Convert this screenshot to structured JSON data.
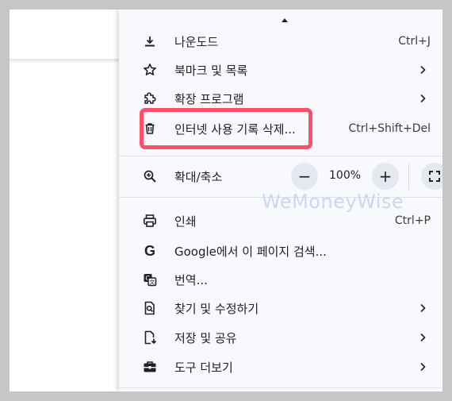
{
  "menu": {
    "items": [
      {
        "name": "download",
        "label": "나운도드",
        "shortcut": "Ctrl+J",
        "icon": "download-icon"
      },
      {
        "name": "bookmarks",
        "label": "북마크 및 목록",
        "submenu": true,
        "icon": "star-icon"
      },
      {
        "name": "extensions",
        "label": "확장 프로그램",
        "submenu": true,
        "icon": "puzzle-icon"
      },
      {
        "name": "clear-history",
        "label": "인터넷 사용 기록 삭제...",
        "shortcut": "Ctrl+Shift+Del",
        "icon": "trash-icon"
      }
    ],
    "zoom": {
      "label": "확대/축소",
      "value": "100%",
      "minus": "−",
      "plus": "+"
    },
    "items2": [
      {
        "name": "print",
        "label": "인쇄",
        "shortcut": "Ctrl+P",
        "icon": "printer-icon"
      },
      {
        "name": "google-search",
        "label": "Google에서 이 페이지 검색...",
        "icon": "google-icon"
      },
      {
        "name": "translate",
        "label": "번역...",
        "icon": "translate-icon"
      },
      {
        "name": "find-edit",
        "label": "찾기 및 수정하기",
        "submenu": true,
        "icon": "find-icon"
      },
      {
        "name": "save-share",
        "label": "저장 및 공유",
        "submenu": true,
        "icon": "save-icon"
      },
      {
        "name": "more-tools",
        "label": "도구 더보기",
        "submenu": true,
        "icon": "toolbox-icon"
      }
    ]
  },
  "watermark": "WeMoneyWise",
  "colors": {
    "highlight": "#ff4f6a",
    "menu_bg": "#f8f9fd"
  }
}
